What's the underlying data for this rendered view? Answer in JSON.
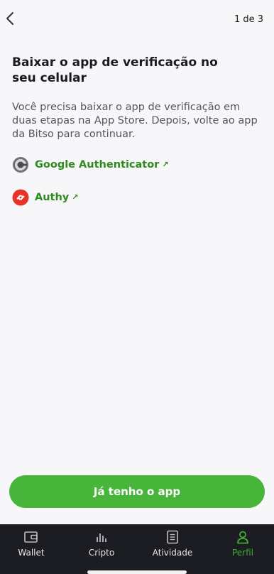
{
  "header": {
    "step_text": "1 de 3"
  },
  "content": {
    "title": "Baixar o app de verificação no seu celular",
    "description": "Você precisa baixar o app de verificação em duas etapas na App Store. Depois, volte ao app da Bitso para continuar.",
    "apps": [
      {
        "label": "Google Authenticator",
        "icon": "google-authenticator-icon",
        "arrow": "↗"
      },
      {
        "label": "Authy",
        "icon": "authy-icon",
        "arrow": "↗"
      }
    ]
  },
  "cta": {
    "label": "Já tenho o app"
  },
  "tabbar": {
    "items": [
      {
        "label": "Wallet",
        "icon": "wallet-icon"
      },
      {
        "label": "Cripto",
        "icon": "chart-icon"
      },
      {
        "label": "Atividade",
        "icon": "document-icon"
      },
      {
        "label": "Perfil",
        "icon": "user-icon",
        "active": true
      }
    ]
  },
  "colors": {
    "accent_green": "#46b53a",
    "link_green": "#2e8b1e",
    "tabbar_bg": "#1c1d22",
    "authy_red": "#e5332a"
  }
}
